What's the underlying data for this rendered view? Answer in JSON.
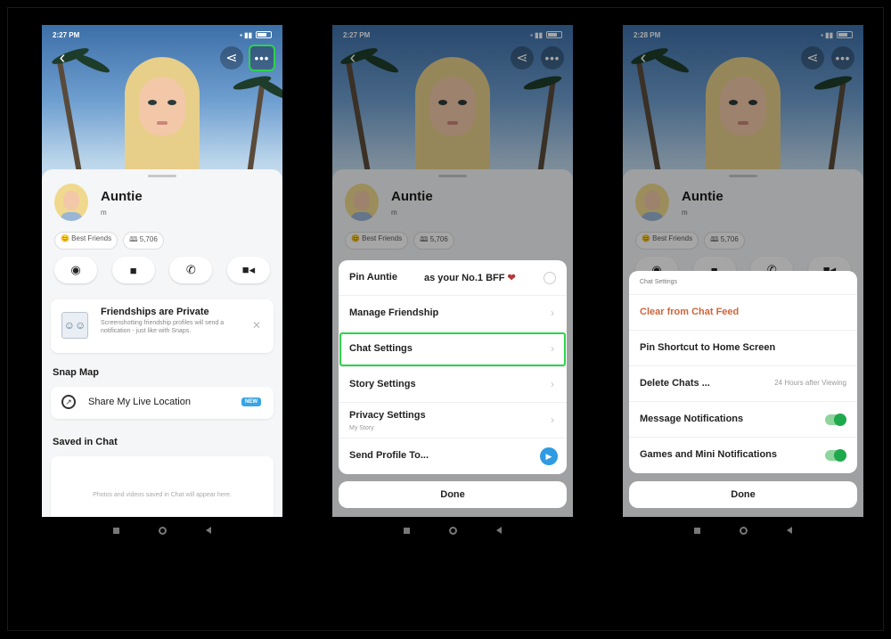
{
  "screens": [
    {
      "status_time": "2:27 PM",
      "profile": {
        "name": "Auntie",
        "username": "m",
        "badge_best_friends": "😊 Best Friends",
        "badge_score": "🕮 5,706"
      },
      "privacy_card": {
        "title": "Friendships are Private",
        "text": "Screenshotting friendship profiles will send a notification - just like with Snaps."
      },
      "snap_map": {
        "section_title": "Snap Map",
        "share_label": "Share My Live Location",
        "new_badge": "NEW"
      },
      "saved": {
        "section_title": "Saved in Chat",
        "empty_text": "Photos and videos saved in Chat will appear here."
      }
    },
    {
      "status_time": "2:27 PM",
      "profile": {
        "name": "Auntie",
        "username": "m",
        "badge_best_friends": "😊 Best Friends",
        "badge_score": "🕮 5,706"
      },
      "menu": {
        "pin_prefix": "Pin Auntie",
        "pin_suffix": "as your No.1 BFF",
        "pin_heart": "❤",
        "items": [
          {
            "label": "Manage Friendship"
          },
          {
            "label": "Chat Settings"
          },
          {
            "label": "Story Settings"
          },
          {
            "label": "Privacy Settings",
            "sub": "My Story"
          },
          {
            "label": "Send Profile To..."
          }
        ],
        "done": "Done"
      }
    },
    {
      "status_time": "2:28 PM",
      "profile": {
        "name": "Auntie",
        "username": "m",
        "badge_best_friends": "😊 Best Friends",
        "badge_score": "🕮 5,706"
      },
      "chat_settings": {
        "header": "Chat Settings",
        "clear": "Clear from Chat Feed",
        "pin_shortcut": "Pin Shortcut to Home Screen",
        "delete_label": "Delete Chats ...",
        "delete_value": "24 Hours after Viewing",
        "msg_notif": "Message Notifications",
        "games_notif": "Games and Mini Notifications",
        "msg_notif_on": true,
        "games_notif_on": true,
        "done": "Done"
      }
    }
  ],
  "colors": {
    "highlight": "#2bd34a",
    "accent_blue": "#2f9be3",
    "danger": "#d0643c",
    "toggle_on": "#1fa94d"
  }
}
